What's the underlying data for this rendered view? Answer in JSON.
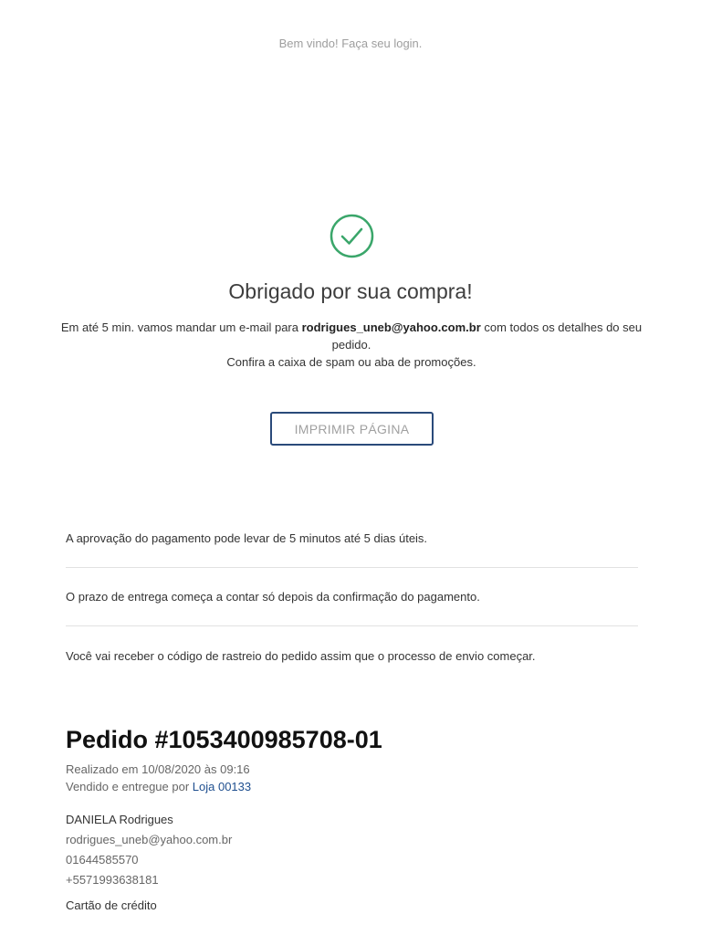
{
  "header": {
    "welcome": "Bem vindo! Faça seu login."
  },
  "confirmation": {
    "icon": "check-circle-icon",
    "icon_color": "#3aa66a",
    "title": "Obrigado por sua compra!",
    "message_prefix": "Em até 5 min. vamos mandar um e-mail para ",
    "email": "rodrigues_uneb@yahoo.com.br",
    "message_suffix": " com todos os detalhes do seu pedido.",
    "message_line2": "Confira a caixa de spam ou aba de promoções.",
    "print_button": "IMPRIMIR PÁGINA"
  },
  "info_items": [
    "A aprovação do pagamento pode levar de 5 minutos até 5 dias úteis.",
    "O prazo de entrega começa a contar só depois da confirmação do pagamento.",
    "Você vai receber o código de rastreio do pedido assim que o processo de envio começar."
  ],
  "order": {
    "title": "Pedido #1053400985708-01",
    "placed_at": "Realizado em 10/08/2020 às 09:16",
    "sold_by_label": "Vendido e entregue por ",
    "store": "Loja 00133",
    "link_color": "#1f4f8f"
  },
  "customer": {
    "name": "DANIELA Rodrigues",
    "email": "rodrigues_uneb@yahoo.com.br",
    "phone1": "01644585570",
    "phone2": "+5571993638181",
    "payment_partial": "Cartão de crédito"
  }
}
